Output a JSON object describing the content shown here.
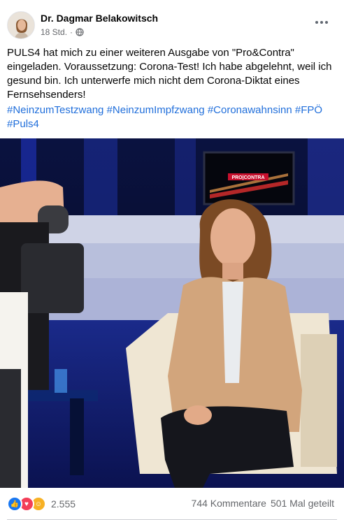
{
  "post": {
    "author": "Dr. Dagmar Belakowitsch",
    "time": "18 Std.",
    "visibility_icon": "globe-icon",
    "more_icon": "more-options-icon",
    "text": "PULS4 hat mich zu einer weiteren Ausgabe von \"Pro&Contra\" eingeladen. Voraussetzung: Corona-Test! Ich habe abgelehnt, weil ich gesund bin. Ich unterwerfe mich nicht dem Corona-Diktat eines Fernsehsenders!",
    "hashtags": [
      "#NeinzumTestzwang",
      "#NeinzumImpfzwang",
      "#Coronawahnsinn",
      "#FPÖ",
      "#Puls4"
    ],
    "photo": {
      "screen_logo": "PRO|CONTRA"
    }
  },
  "footer": {
    "reaction_icons": [
      "like-icon",
      "love-icon",
      "care-icon"
    ],
    "reaction_count": "2.555",
    "comments": "744 Kommentare",
    "shares": "501 Mal geteilt"
  },
  "colors": {
    "link": "#216fdb",
    "secondary_text": "#65676b",
    "like": "#1877f2",
    "love": "#f33e58",
    "care": "#f7b125"
  }
}
